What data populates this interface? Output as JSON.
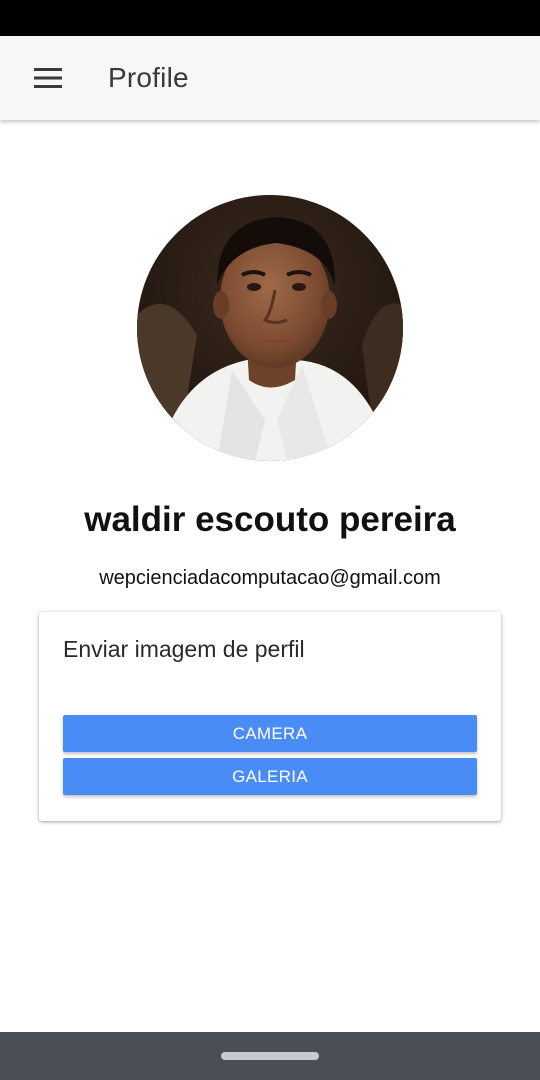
{
  "app_bar": {
    "menu_icon": "hamburger-menu-icon",
    "title": "Profile"
  },
  "profile": {
    "avatar": "profile-photo",
    "name": "waldir escouto pereira",
    "email": "wepcienciadacomputacao@gmail.com"
  },
  "upload_card": {
    "title": "Enviar imagem de perfil",
    "camera_label": "CAMERA",
    "gallery_label": "GALERIA"
  },
  "colors": {
    "status_bar": "#000000",
    "app_bar": "#f7f7f7",
    "button": "#4a8cf6",
    "nav_bar": "#4a4f55"
  }
}
